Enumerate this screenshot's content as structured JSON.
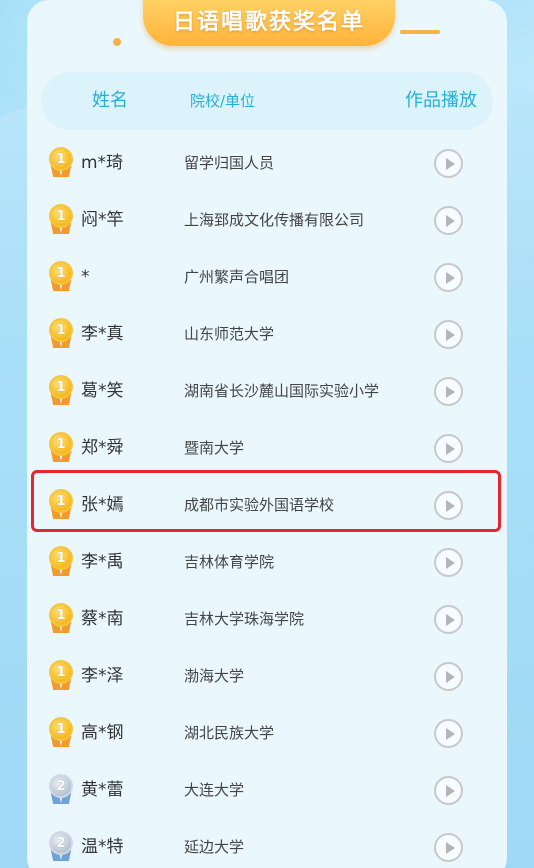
{
  "title": "日语唱歌获奖名单",
  "header": {
    "name": "姓名",
    "unit": "院校/单位",
    "play": "作品播放"
  },
  "colors": {
    "accent": "#26b0d8",
    "banner": "#ffb33a",
    "highlight": "#e5262c"
  },
  "rows": [
    {
      "rank": "1",
      "name": "m*琦",
      "unit": "留学归国人员"
    },
    {
      "rank": "1",
      "name": "闷*竿",
      "unit": "上海郅成文化传播有限公司"
    },
    {
      "rank": "1",
      "name": "*",
      "unit": "广州繁声合唱团"
    },
    {
      "rank": "1",
      "name": "李*真",
      "unit": "山东师范大学"
    },
    {
      "rank": "1",
      "name": "葛*笑",
      "unit": "湖南省长沙麓山国际实验小学"
    },
    {
      "rank": "1",
      "name": "郑*舜",
      "unit": "暨南大学"
    },
    {
      "rank": "1",
      "name": "张*嫣",
      "unit": "成都市实验外国语学校"
    },
    {
      "rank": "1",
      "name": "李*禹",
      "unit": "吉林体育学院"
    },
    {
      "rank": "1",
      "name": "蔡*南",
      "unit": "吉林大学珠海学院"
    },
    {
      "rank": "1",
      "name": "李*泽",
      "unit": "渤海大学"
    },
    {
      "rank": "1",
      "name": "高*钢",
      "unit": "湖北民族大学"
    },
    {
      "rank": "2",
      "name": "黄*蕾",
      "unit": "大连大学"
    },
    {
      "rank": "2",
      "name": "温*特",
      "unit": "延边大学"
    }
  ]
}
